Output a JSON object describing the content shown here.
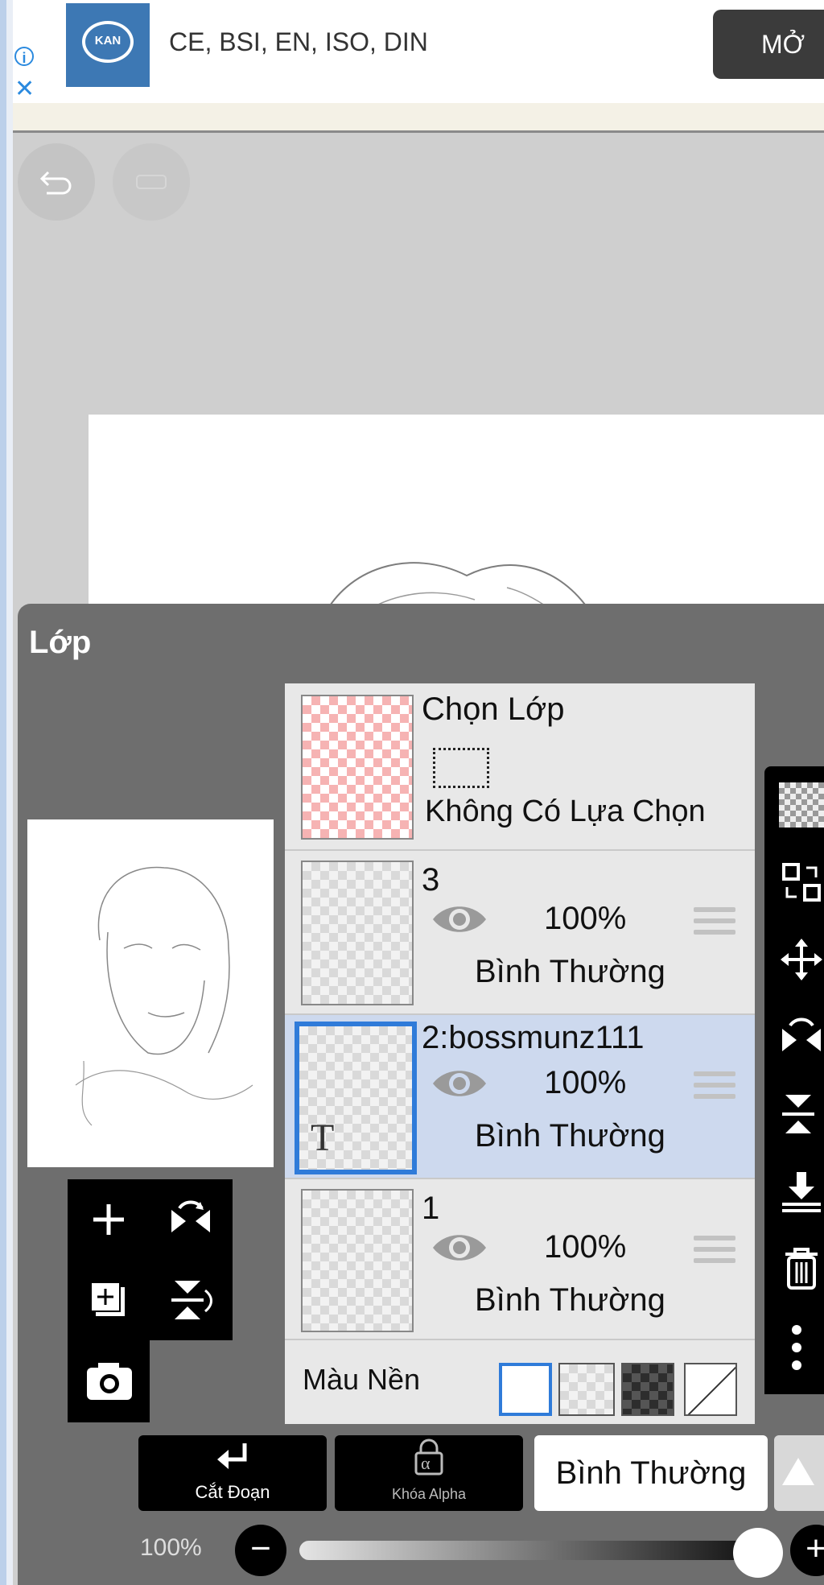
{
  "ad": {
    "info_glyph": "i",
    "close_glyph": "✕",
    "logo_text": "KAN",
    "text": "CE, BSI, EN, ISO, DIN",
    "open_label": "MỞ"
  },
  "layer_panel": {
    "title": "Lớp",
    "selection_layer": {
      "title": "Chọn Lớp",
      "status": "Không Có Lựa Chọn"
    },
    "layers": [
      {
        "name": "3",
        "opacity": "100%",
        "blend": "Bình Thường",
        "visible": true,
        "selected": false
      },
      {
        "name": "2:bossmunz111",
        "opacity": "100%",
        "blend": "Bình Thường",
        "visible": true,
        "selected": true,
        "type_glyph": "T"
      },
      {
        "name": "1",
        "opacity": "100%",
        "blend": "Bình Thường",
        "visible": true,
        "selected": false
      }
    ],
    "background": {
      "label": "Màu Nền",
      "selected": "white"
    }
  },
  "bottom_bar": {
    "clip_label": "Cắt Đoạn",
    "alpha_lock_label": "Khóa Alpha",
    "alpha_glyph": "α",
    "blend_mode": "Bình Thường"
  },
  "opacity_slider": {
    "label": "100%",
    "value": 1.0,
    "minus_glyph": "−",
    "plus_glyph": "+"
  },
  "colors": {
    "selection_blue": "#2f7bd9",
    "selected_row": "#cdd9ee",
    "panel_gray": "#6e6e6e",
    "ad_blue": "#3d78b4"
  }
}
